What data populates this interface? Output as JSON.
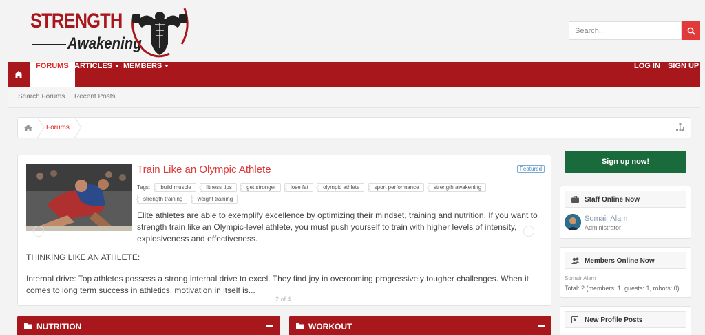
{
  "header": {
    "logo_top": "STRENGTH",
    "logo_bottom": "Awakening",
    "search_placeholder": "Search..."
  },
  "nav": {
    "tabs": [
      {
        "label": "FORUMS"
      },
      {
        "label": "ARTICLES"
      },
      {
        "label": "MEMBERS"
      }
    ],
    "login": "LOG IN",
    "signup": "SIGN UP"
  },
  "subnav": {
    "items": [
      "Search Forums",
      "Recent Posts"
    ]
  },
  "breadcrumb": {
    "item": "Forums"
  },
  "featured": {
    "title": "Train Like an Olympic Athlete",
    "badge": "Featured",
    "tags_label": "Tags:",
    "tags": [
      "build muscle",
      "fitness tips",
      "get stronger",
      "lose fat",
      "olympic athlete",
      "sport performance",
      "strength awakening",
      "strength training",
      "weight training"
    ],
    "intro": "Elite athletes are able to exemplify excellence by optimizing their mindset, training and nutrition. If you want to strength train like an Olympic-level athlete, you must push yourself to train with higher levels of intensity, explosiveness and effectiveness.",
    "heading": "THINKING LIKE AN ATHLETE:",
    "body": "Internal drive: Top athletes possess a strong internal drive to excel. They find joy in overcoming progressively tougher challenges. When it comes to long term success in athletics, motivation in itself is...",
    "pager": "2 of 4"
  },
  "sidebar": {
    "signup_button": "Sign up now!",
    "staff_title": "Staff Online Now",
    "staff_name": "Somair Alam",
    "staff_role": "Administrator",
    "members_title": "Members Online Now",
    "members_list": "Somair Alam",
    "members_total": "Total: 2 (members: 1, guests: 1, robots: 0)",
    "profile_title": "New Profile Posts"
  },
  "categories": [
    {
      "label": "NUTRITION"
    },
    {
      "label": "WORKOUT"
    }
  ],
  "colors": {
    "brand": "#a8171c",
    "accent": "#e03a3a",
    "signup": "#1a6b3c"
  }
}
